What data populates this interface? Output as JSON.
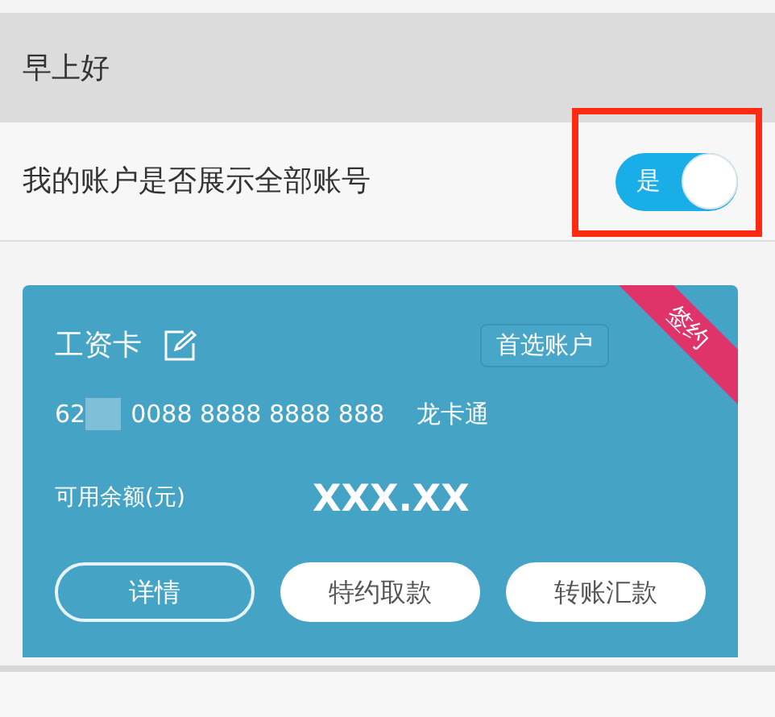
{
  "greeting": "早上好",
  "setting": {
    "label": "我的账户是否展示全部账号",
    "toggle_text": "是",
    "on": true,
    "highlighted": true
  },
  "card": {
    "name": "工资卡",
    "preferred_label": "首选账户",
    "ribbon": "签约",
    "number_prefix": "62",
    "number_rest": "0088 8888 8888 888",
    "card_type": "龙卡通",
    "balance_label": "可用余额(元)",
    "balance": "XXX.XX",
    "buttons": [
      {
        "label": "详情",
        "kind": "outline"
      },
      {
        "label": "特约取款",
        "kind": "filled"
      },
      {
        "label": "转账汇款",
        "kind": "filled"
      }
    ]
  }
}
